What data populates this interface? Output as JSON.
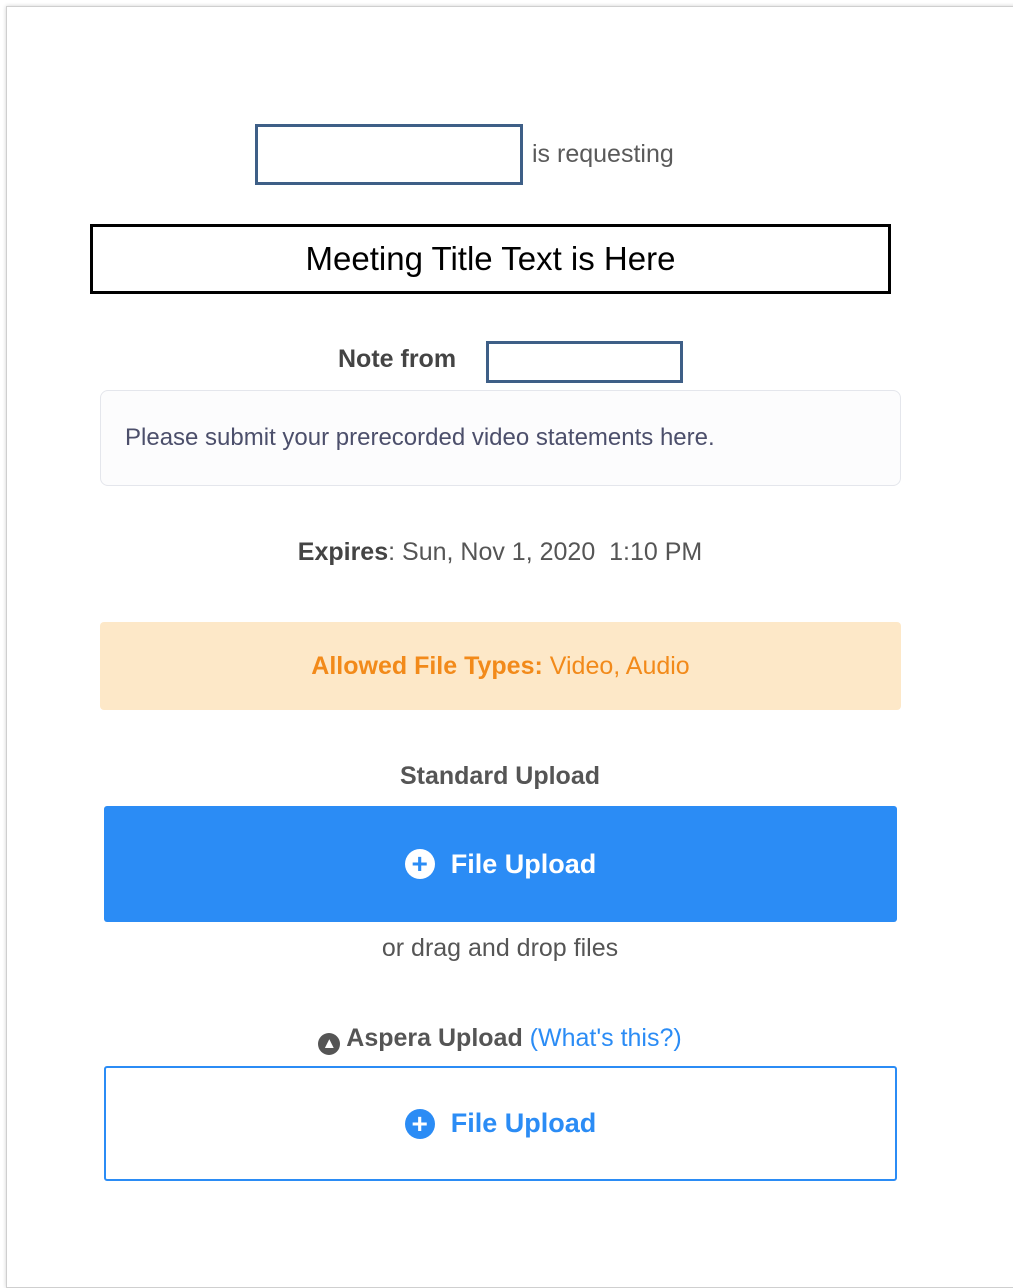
{
  "header": {
    "requesting_text": "is requesting",
    "meeting_title": "Meeting Title Text is Here"
  },
  "note": {
    "label": "Note from",
    "message": "Please submit your prerecorded video statements here."
  },
  "expires": {
    "label": "Expires",
    "value": "Sun, Nov 1, 2020  1:10 PM"
  },
  "allowed": {
    "label": "Allowed File Types:",
    "value": "Video, Audio"
  },
  "standard_upload": {
    "label": "Standard Upload",
    "button_label": "File Upload",
    "drag_text": "or drag and drop files"
  },
  "aspera_upload": {
    "label": "Aspera Upload",
    "help_link": "(What's this?)",
    "button_label": "File Upload",
    "icon": "aspera-icon"
  },
  "colors": {
    "primary_blue": "#2b8cf5",
    "warning_bg": "#fde8c8",
    "warning_text": "#f28a1a",
    "redaction_border": "#3e5f87"
  }
}
